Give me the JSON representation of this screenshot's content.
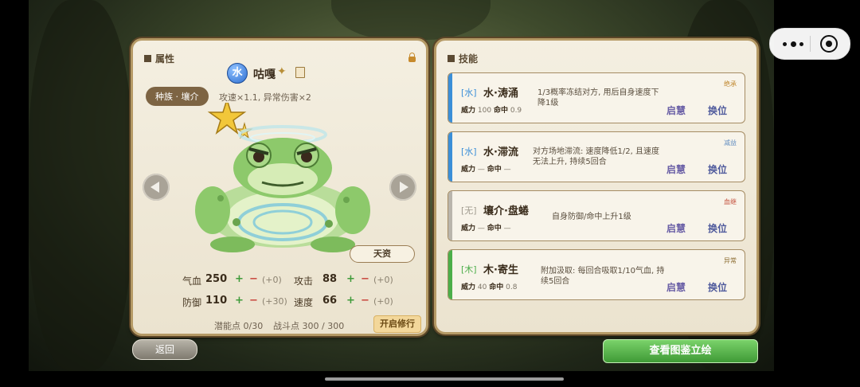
{
  "attributes_panel": {
    "title": "属性",
    "element_badge": "水",
    "pet_name": "咕嘎",
    "race_tag": "种族 · 壤介",
    "race_desc": "攻速×1.1, 异常伤害×2",
    "talent_button": "天资",
    "stats": [
      {
        "label": "气血",
        "value": "250",
        "plus": "+",
        "minus": "−",
        "bonus": "(+0)"
      },
      {
        "label": "攻击",
        "value": "88",
        "plus": "+",
        "minus": "−",
        "bonus": "(+0)"
      },
      {
        "label": "防御",
        "value": "110",
        "plus": "+",
        "minus": "−",
        "bonus": "(+30)"
      },
      {
        "label": "速度",
        "value": "66",
        "plus": "+",
        "minus": "−",
        "bonus": "(+0)"
      }
    ],
    "potential_points": "潜能点 0/30",
    "battle_points": "战斗点 300 / 300",
    "train_button": "开启修行",
    "icons": [
      "lock-icon",
      "edit-icon",
      "star-icon",
      "arrow-left-icon",
      "arrow-right-icon"
    ]
  },
  "skills_panel": {
    "title": "技能",
    "skills": [
      {
        "type": "[水]",
        "name": "水·涛涌",
        "power_label": "威力",
        "power": "100",
        "acc_label": "命中",
        "acc": "0.9",
        "desc": "1/3概率冻结对方, 用后自身速度下降1级",
        "tag": "绝承",
        "btn1": "启慧",
        "btn2": "换位",
        "color": "#3b8fd8",
        "tag_color": "#c0872e"
      },
      {
        "type": "[水]",
        "name": "水·滞流",
        "power_label": "威力",
        "power": "—",
        "acc_label": "命中",
        "acc": "—",
        "desc": "对方场地滞流: 速度降低1/2, 且速度无法上升, 持续5回合",
        "tag": "减益",
        "btn1": "启慧",
        "btn2": "换位",
        "color": "#3b8fd8",
        "tag_color": "#5f8bc0"
      },
      {
        "type": "[无]",
        "name": "壤介·盘蜷",
        "power_label": "威力",
        "power": "—",
        "acc_label": "命中",
        "acc": "—",
        "desc": "自身防御/命中上升1级",
        "tag": "血继",
        "btn1": "启慧",
        "btn2": "换位",
        "color": "#b9b5ac",
        "tag_color": "#c4513d"
      },
      {
        "type": "[木]",
        "name": "木·寄生",
        "power_label": "威力",
        "power": "40",
        "acc_label": "命中",
        "acc": "0.8",
        "desc": "附加汲取: 每回合吸取1/10气血, 持续5回合",
        "tag": "异常",
        "btn1": "启慧",
        "btn2": "换位",
        "color": "#4cae4a",
        "tag_color": "#8a6a2e"
      }
    ]
  },
  "footer": {
    "back_button": "返回",
    "gallery_button": "查看图鉴立绘"
  },
  "mini_capsule": {
    "more_icon": "more-dots-icon",
    "close_icon": "target-circle-icon"
  }
}
